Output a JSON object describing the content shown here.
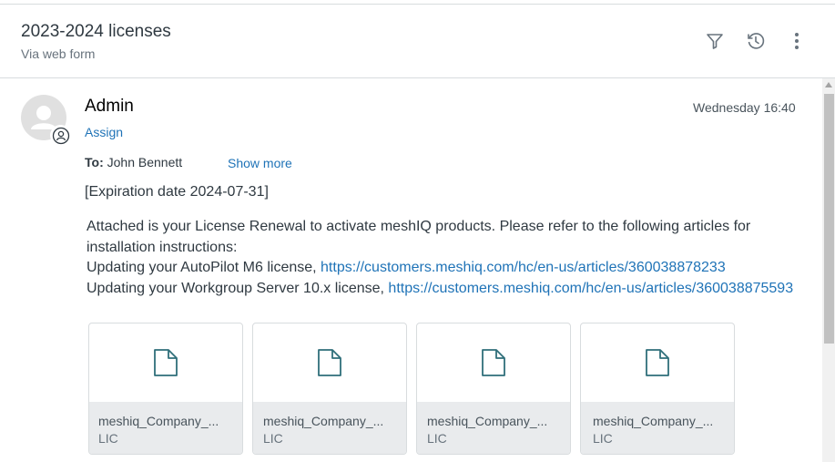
{
  "ticket": {
    "subject": "2023-2024 licenses",
    "channel": "Via web form"
  },
  "header_icons": [
    "filter-icon",
    "history-icon",
    "more-vertical-icon"
  ],
  "message": {
    "sender": "Admin",
    "assign_label": "Assign",
    "timestamp": "Wednesday 16:40",
    "to_label": "To:",
    "to_name": "John Bennett",
    "show_more": "Show more",
    "expiration": "[Expiration date 2024-07-31]",
    "intro": "Attached is your License Renewal to activate meshIQ products. Please refer to the following articles for installation instructions:",
    "line1_text": "Updating your AutoPilot M6 license, ",
    "line1_link": "https://customers.meshiq.com/hc/en-us/articles/360038878233",
    "line2_text": "Updating your Workgroup Server 10.x license, ",
    "line2_link": "https://customers.meshiq.com/hc/en-us/articles/360038875593"
  },
  "attachments": [
    {
      "name": "meshiq_Company_...",
      "ext": "LIC"
    },
    {
      "name": "meshiq_Company_...",
      "ext": "LIC"
    },
    {
      "name": "meshiq_Company_...",
      "ext": "LIC"
    },
    {
      "name": "meshiq_Company_...",
      "ext": "LIC"
    }
  ],
  "colors": {
    "link": "#1f73b7",
    "icon_teal": "#2f6f7a",
    "text": "#2f3941"
  }
}
